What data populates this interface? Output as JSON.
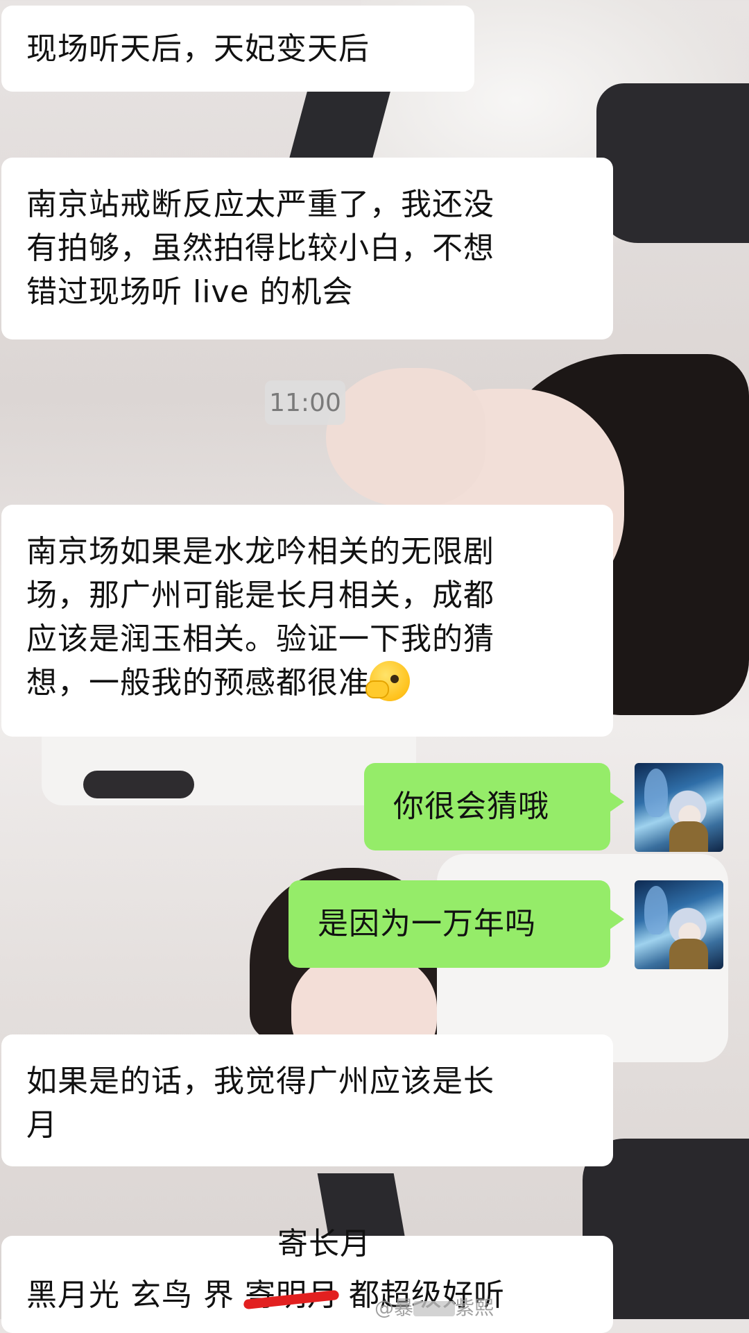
{
  "messages": {
    "m1": "现场听天后，天妃变天后",
    "m2_lines": [
      "南京站戒断反应太严重了，我还没",
      "有拍够，虽然拍得比较小白，不想",
      "错过现场听 live 的机会"
    ],
    "time": "11:00",
    "m3_lines": [
      "南京场如果是水龙吟相关的无限剧",
      "场，那广州可能是长月相关，成都",
      "应该是润玉相关。验证一下我的猜",
      "想，一般我的预感都很准"
    ],
    "m3_emoji": "face-with-hand-over-mouth-emoji",
    "m4": "你很会猜哦",
    "m5": "是因为一万年吗",
    "m6_lines": [
      "如果是的话，我觉得广州应该是长",
      "月"
    ],
    "m7": {
      "part1": "黑月光 玄鸟 界 ",
      "struck": "寄明月",
      "part2": " 都超级好听",
      "correction": "寄长月"
    }
  },
  "watermark": {
    "prefix": "@暴",
    "suffix": "紫熙"
  },
  "colors": {
    "sent_bubble": "#95ec69",
    "received_bubble": "#ffffff",
    "strike": "#e22020"
  }
}
